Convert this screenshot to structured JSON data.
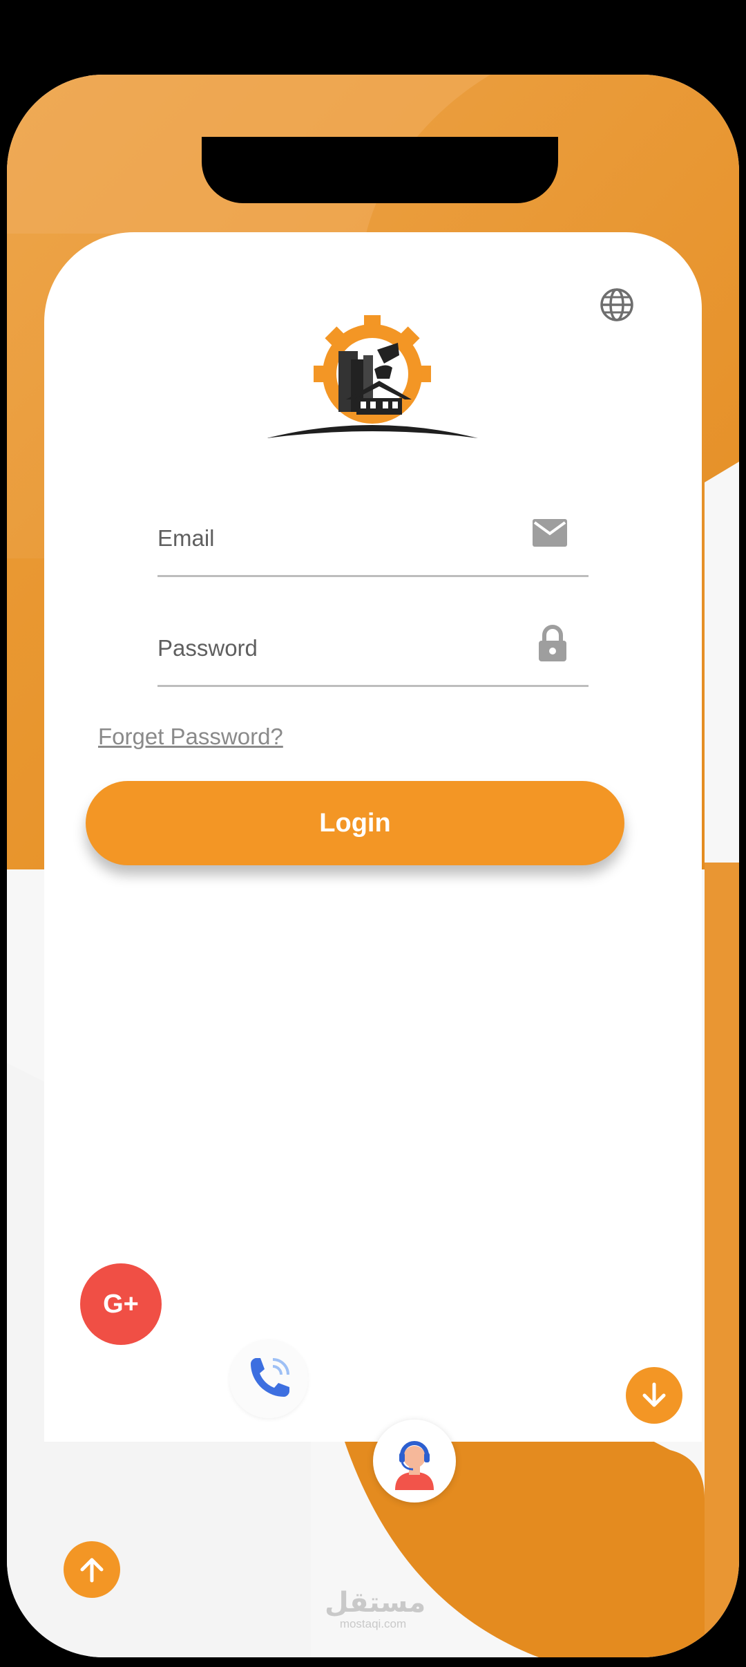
{
  "login_form": {
    "email_label": "Email",
    "password_label": "Password",
    "forgot_link": "Forget Password?",
    "login_button": "Login"
  },
  "social": {
    "google_plus_label": "G+"
  },
  "watermark": {
    "arabic": "مستقل",
    "latin": "mostaqi.com"
  },
  "icons": [
    "globe-icon",
    "app-logo",
    "mail-icon",
    "lock-icon",
    "google-plus-icon",
    "phone-call-icon",
    "support-agent-icon",
    "arrow-down-icon",
    "arrow-up-icon"
  ],
  "colors": {
    "accent": "#f39625",
    "google_red": "#f04f45",
    "phone_blue": "#3d6fe0",
    "text_muted": "#8a8a8a"
  }
}
